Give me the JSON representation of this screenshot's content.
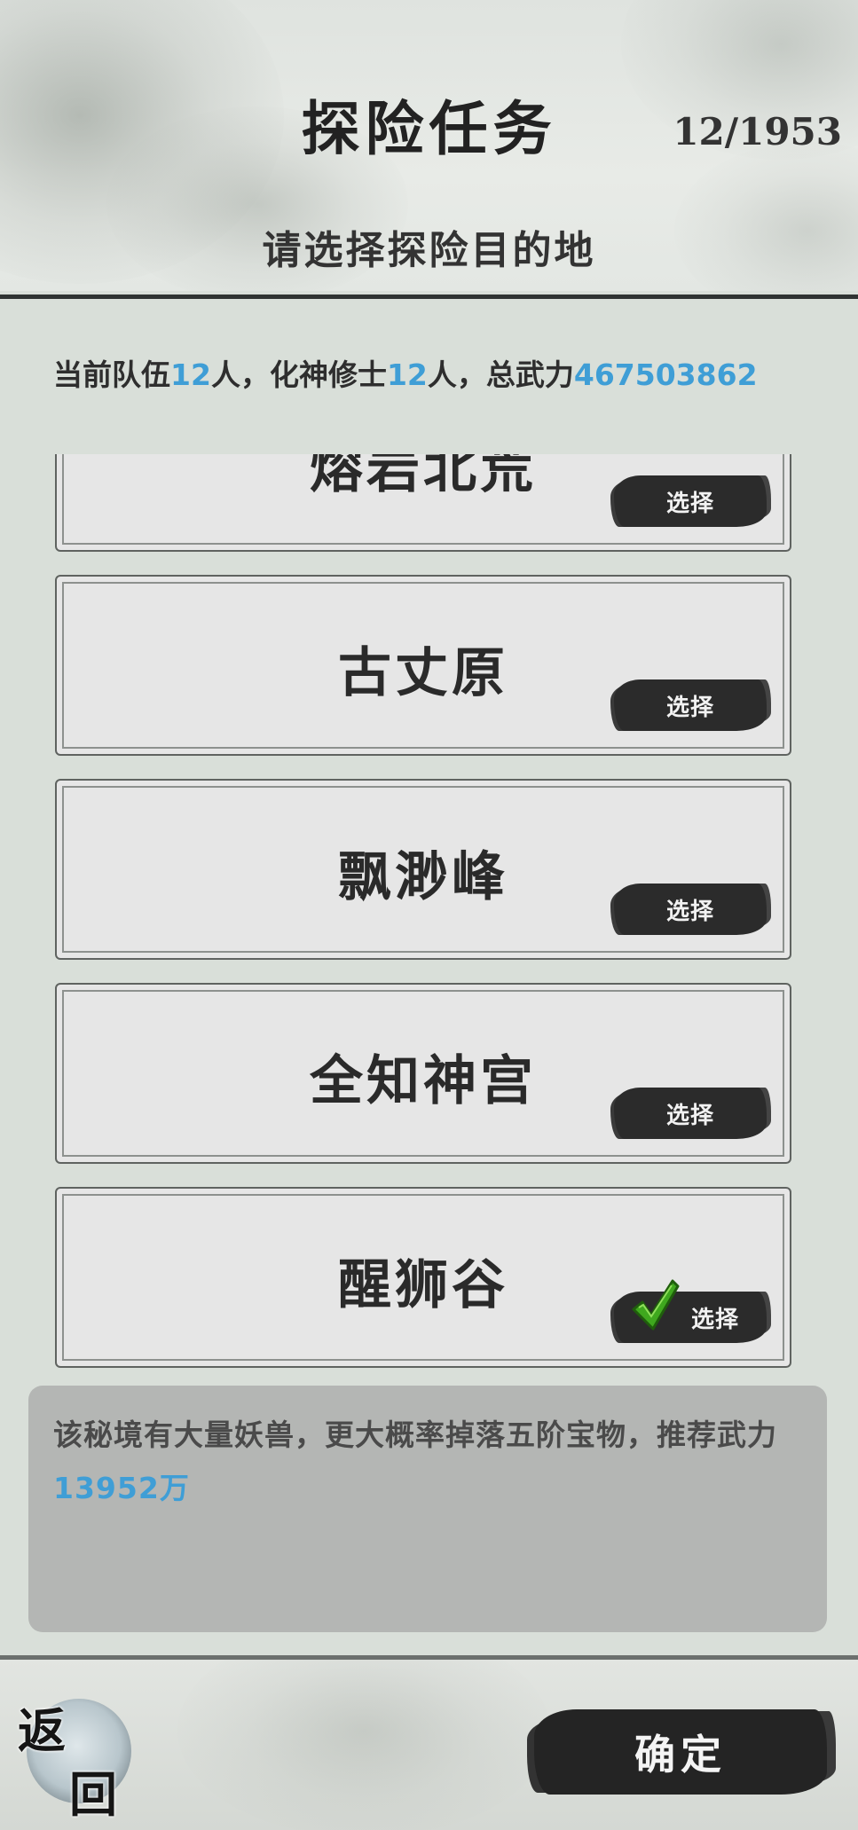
{
  "header": {
    "title": "探险任务",
    "counter": "12/1953",
    "subtitle": "请选择探险目的地"
  },
  "team": {
    "prefix": "当前队伍",
    "members": "12",
    "members_unit": "人，",
    "cultivator_label": "化神修士",
    "cultivators": "12",
    "cultivators_unit": "人，",
    "power_label": "总武力",
    "power": "467503862"
  },
  "destinations": [
    {
      "name": "熔岩北荒",
      "select_label": "选择",
      "selected": false
    },
    {
      "name": "古丈原",
      "select_label": "选择",
      "selected": false
    },
    {
      "name": "飘渺峰",
      "select_label": "选择",
      "selected": false
    },
    {
      "name": "全知神宫",
      "select_label": "选择",
      "selected": false
    },
    {
      "name": "醒狮谷",
      "select_label": "选择",
      "selected": true
    }
  ],
  "description": {
    "text": "该秘境有大量妖兽，更大概率掉落五阶宝物，推荐武力",
    "power": "13952",
    "unit": "万"
  },
  "footer": {
    "back_char_1": "返",
    "back_char_2": "回",
    "confirm_label": "确定"
  },
  "colors": {
    "highlight": "#3f9ed6",
    "button": "#2b2b2b",
    "check": "#3fa81e"
  },
  "icons": {
    "selected_mark": "checkmark-icon"
  }
}
